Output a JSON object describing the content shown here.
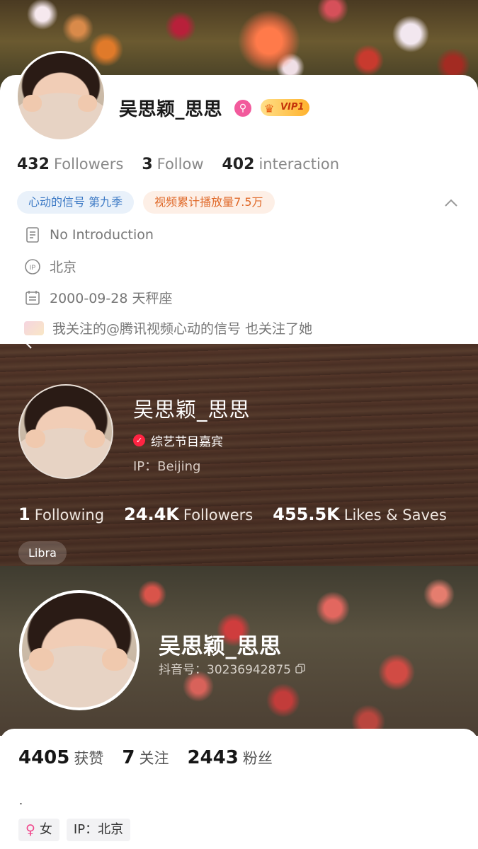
{
  "weibo": {
    "name": "吴思颖_思思",
    "vip_label": "VIP1",
    "stats": [
      {
        "value": "432",
        "label": "Followers"
      },
      {
        "value": "3",
        "label": "Follow"
      },
      {
        "value": "402",
        "label": "interaction"
      }
    ],
    "tags": [
      "心动的信号 第九季",
      "视频累计播放量7.5万"
    ],
    "intro": "No Introduction",
    "ip": "北京",
    "birthday": "2000-09-28 天秤座",
    "mutual": "我关注的@腾讯视频心动的信号 也关注了她"
  },
  "xhs": {
    "name": "吴思颖_思思",
    "badge": "综艺节目嘉宾",
    "ip": "IP：Beijing",
    "stats": [
      {
        "value": "1",
        "label": "Following"
      },
      {
        "value": "24.4K",
        "label": "Followers"
      },
      {
        "value": "455.5K",
        "label": "Likes & Saves"
      }
    ],
    "tag": "Libra"
  },
  "douyin": {
    "name": "吴思颖_思思",
    "id": "抖音号：30236942875",
    "stats": [
      {
        "value": "4405",
        "label": "获赞"
      },
      {
        "value": "7",
        "label": "关注"
      },
      {
        "value": "2443",
        "label": "粉丝"
      }
    ],
    "bio": ".",
    "gender": "女",
    "gender_symbol": "♀",
    "ip": "IP：北京"
  },
  "colors": {
    "weibo_vip": "#ffb22c",
    "weibo_verify": "#f25a9c",
    "xhs_red": "#ff2442",
    "tag_blue": "#3a78c4",
    "tag_orange": "#e06a2a"
  }
}
